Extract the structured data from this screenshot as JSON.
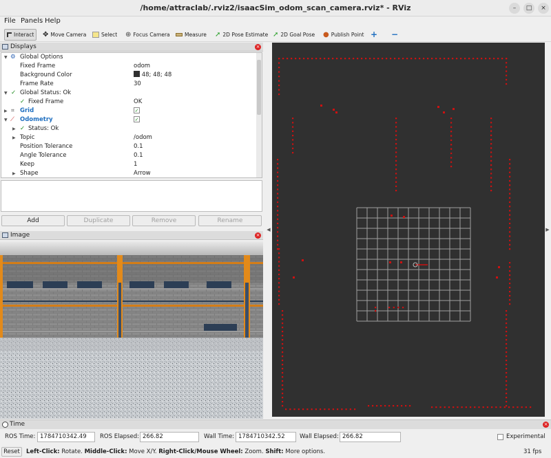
{
  "window": {
    "title": "/home/attraclab/.rviz2/isaacSim_odom_scan_camera.rviz* - RViz",
    "minimize": "–",
    "maximize": "□",
    "close": "×"
  },
  "menu": {
    "file": "File",
    "panels": "Panels",
    "help": "Help"
  },
  "toolbar": {
    "interact": "Interact",
    "move_camera": "Move Camera",
    "select": "Select",
    "focus_camera": "Focus Camera",
    "measure": "Measure",
    "pose_estimate": "2D Pose Estimate",
    "goal_pose": "2D Goal Pose",
    "publish_point": "Publish Point",
    "add_tool": "+",
    "remove_tool": "−"
  },
  "displays": {
    "title": "Displays",
    "rows": [
      {
        "label": "Global Options",
        "value": ""
      },
      {
        "label": "Fixed Frame",
        "value": "odom"
      },
      {
        "label": "Background Color",
        "value": "48; 48; 48"
      },
      {
        "label": "Frame Rate",
        "value": "30"
      },
      {
        "label": "Global Status: Ok",
        "value": ""
      },
      {
        "label": "Fixed Frame",
        "value": "OK"
      },
      {
        "label": "Grid",
        "value": "✓"
      },
      {
        "label": "Odometry",
        "value": "✓"
      },
      {
        "label": "Status: Ok",
        "value": ""
      },
      {
        "label": "Topic",
        "value": "/odom"
      },
      {
        "label": "Position Tolerance",
        "value": "0.1"
      },
      {
        "label": "Angle Tolerance",
        "value": "0.1"
      },
      {
        "label": "Keep",
        "value": "1"
      },
      {
        "label": "Shape",
        "value": "Arrow"
      }
    ],
    "background_color": "#303030",
    "buttons": {
      "add": "Add",
      "duplicate": "Duplicate",
      "remove": "Remove",
      "rename": "Rename"
    }
  },
  "image_panel": {
    "title": "Image"
  },
  "time": {
    "title": "Time",
    "ros_time_label": "ROS Time:",
    "ros_time": "1784710342.49",
    "ros_elapsed_label": "ROS Elapsed:",
    "ros_elapsed": "266.82",
    "wall_time_label": "Wall Time:",
    "wall_time": "1784710342.52",
    "wall_elapsed_label": "Wall Elapsed:",
    "wall_elapsed": "266.82",
    "experimental": "Experimental"
  },
  "status": {
    "reset": "Reset",
    "hint_left_key": "Left-Click:",
    "hint_left": " Rotate. ",
    "hint_middle_key": "Middle-Click:",
    "hint_middle": " Move X/Y. ",
    "hint_right_key": "Right-Click/Mouse Wheel:",
    "hint_right": " Zoom. ",
    "hint_shift_key": "Shift:",
    "hint_shift": " More options.",
    "fps": "31 fps"
  },
  "colors": {
    "scan": "#cc1111",
    "grid": "#a0a0a0",
    "viewport_bg": "#303030"
  }
}
